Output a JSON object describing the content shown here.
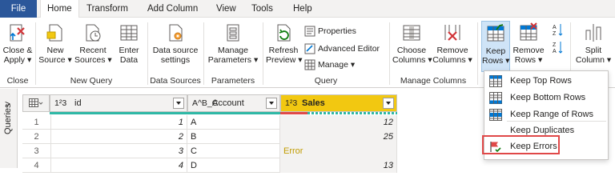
{
  "menu": {
    "tabs": [
      "File",
      "Home",
      "Transform",
      "Add Column",
      "View",
      "Tools",
      "Help"
    ],
    "active": "Home"
  },
  "ribbon": {
    "close_apply": {
      "l1": "Close &",
      "l2": "Apply ▾"
    },
    "new_source": {
      "l1": "New",
      "l2": "Source ▾"
    },
    "recent_sources": {
      "l1": "Recent",
      "l2": "Sources ▾"
    },
    "enter_data": {
      "l1": "Enter",
      "l2": "Data"
    },
    "data_source_settings": {
      "l1": "Data source",
      "l2": "settings"
    },
    "manage_parameters": {
      "l1": "Manage",
      "l2": "Parameters ▾"
    },
    "refresh_preview": {
      "l1": "Refresh",
      "l2": "Preview ▾"
    },
    "properties": "Properties",
    "advanced_editor": "Advanced Editor",
    "manage": "Manage ▾",
    "choose_columns": {
      "l1": "Choose",
      "l2": "Columns ▾"
    },
    "remove_columns": {
      "l1": "Remove",
      "l2": "Columns ▾"
    },
    "keep_rows": {
      "l1": "Keep",
      "l2": "Rows ▾"
    },
    "remove_rows": {
      "l1": "Remove",
      "l2": "Rows ▾"
    },
    "split_column": {
      "l1": "Split",
      "l2": "Column ▾"
    },
    "groups": {
      "close": "Close",
      "new_query": "New Query",
      "data_sources": "Data Sources",
      "parameters": "Parameters",
      "query": "Query",
      "manage_columns": "Manage Columns"
    }
  },
  "queries_pane": {
    "label": "Queries",
    "toggle": ">"
  },
  "grid": {
    "columns": [
      {
        "type": "1²3",
        "name": "id"
      },
      {
        "type": "A^B_C",
        "name": "Account"
      },
      {
        "type": "1²3",
        "name": "Sales"
      }
    ],
    "rows": [
      {
        "n": "1",
        "id": "1",
        "account": "A",
        "sales": "12"
      },
      {
        "n": "2",
        "id": "2",
        "account": "B",
        "sales": "25"
      },
      {
        "n": "3",
        "id": "3",
        "account": "C",
        "sales": "Error"
      },
      {
        "n": "4",
        "id": "4",
        "account": "D",
        "sales": "13"
      }
    ]
  },
  "keep_rows_menu": {
    "items": [
      "Keep Top Rows",
      "Keep Bottom Rows",
      "Keep Range of Rows",
      "Keep Duplicates",
      "Keep Errors"
    ],
    "highlighted": "Keep Errors"
  },
  "colors": {
    "file_tab": "#2b579a",
    "sales_header": "#f2c811",
    "error_text": "#c19c00",
    "quality_ok": "#2eb8a6",
    "quality_error": "#e04848",
    "highlight_box": "#e04848"
  }
}
